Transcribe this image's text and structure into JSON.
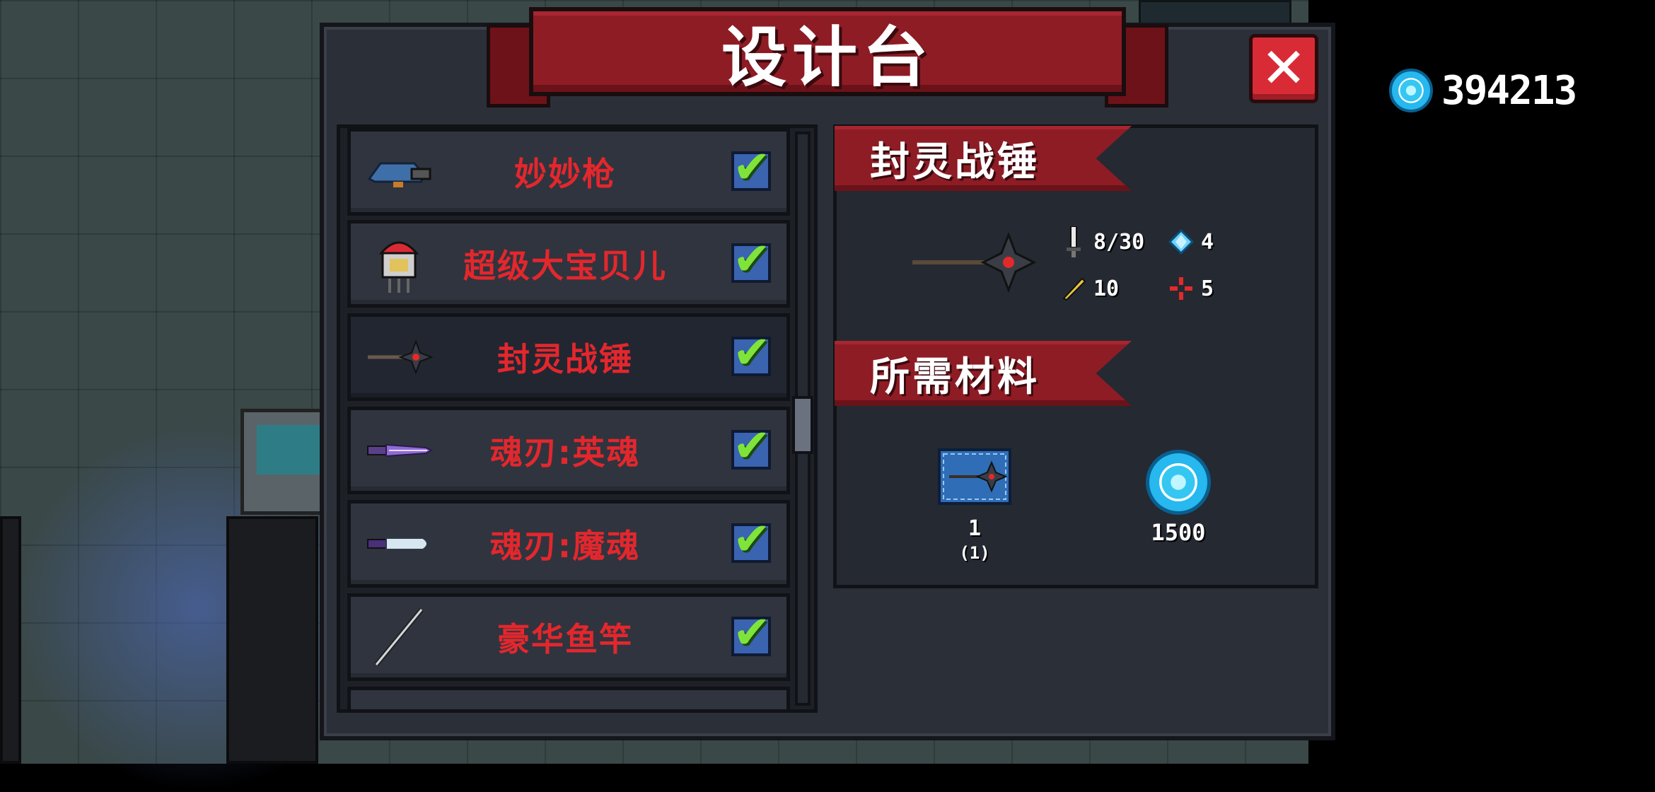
{
  "currency": {
    "icon": "gem-coin-icon",
    "value": "394213"
  },
  "panel": {
    "title": "设计台",
    "close_label": "✕"
  },
  "list": {
    "items": [
      {
        "name": "妙妙枪",
        "icon": "blue-gun-icon",
        "checked": true
      },
      {
        "name": "超级大宝贝儿",
        "icon": "red-helmet-creature-icon",
        "checked": true
      },
      {
        "name": "封灵战锤",
        "icon": "spiked-hammer-icon",
        "checked": true,
        "selected": true
      },
      {
        "name": "魂刃:英魂",
        "icon": "purple-sword-icon",
        "checked": true
      },
      {
        "name": "魂刃:魔魂",
        "icon": "purple-blade-icon",
        "checked": true
      },
      {
        "name": "豪华鱼竿",
        "icon": "fishing-rod-icon",
        "checked": true
      }
    ]
  },
  "detail": {
    "weapon_title": "封灵战锤",
    "stats": {
      "damage": "8/30",
      "energy": "4",
      "crit": "10",
      "accuracy": "5"
    },
    "materials_title": "所需材料",
    "materials": [
      {
        "icon": "blueprint-hammer-icon",
        "count": "1",
        "owned": "(1)"
      },
      {
        "icon": "gem-coin-icon",
        "count": "1500"
      }
    ]
  }
}
